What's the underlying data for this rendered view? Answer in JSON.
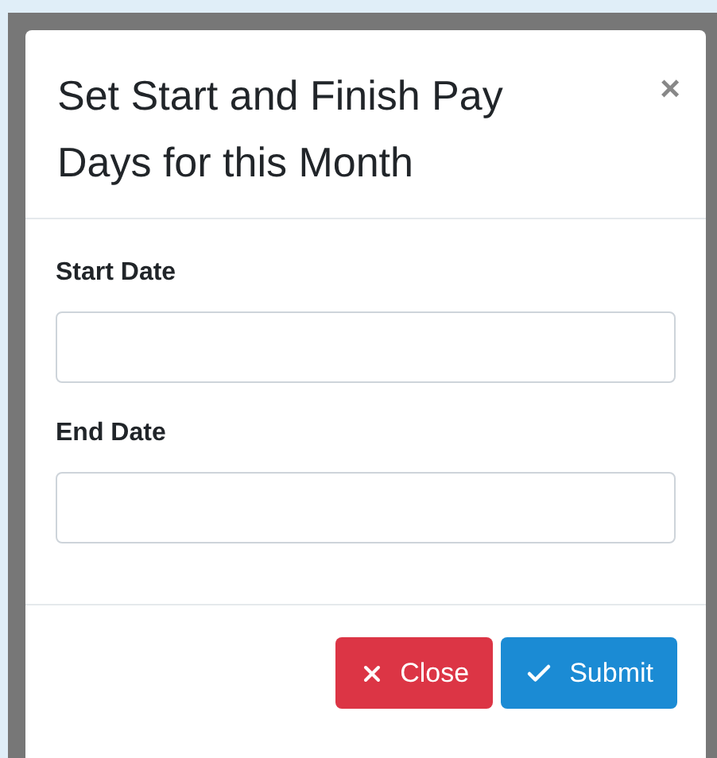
{
  "modal": {
    "title": "Set Start and Finish Pay Days for this Month",
    "close_glyph": "×",
    "fields": [
      {
        "label": "Start Date"
      },
      {
        "label": "End Date"
      }
    ],
    "buttons": [
      {
        "label": "Close",
        "kind": "danger"
      },
      {
        "label": "Submit",
        "kind": "primary"
      }
    ]
  }
}
